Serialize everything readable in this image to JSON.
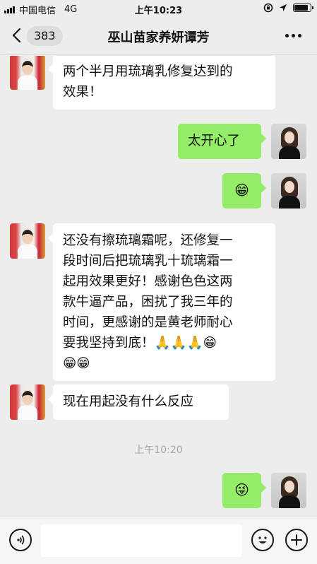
{
  "status_bar": {
    "carrier": "中国电信",
    "network": "4G",
    "time": "上午10:23"
  },
  "nav": {
    "back_count": "383",
    "title": "巫山苗家养妍谭芳"
  },
  "messages": [
    {
      "side": "left",
      "lines": [
        "两个半月用琉璃乳修复达到的",
        "效果！"
      ]
    },
    {
      "side": "right",
      "lines": [
        "太开心了"
      ]
    },
    {
      "side": "right",
      "emoji": "😁"
    },
    {
      "side": "left",
      "lines": [
        "还没有擦琉璃霜呢，还修复一",
        "段时间后把琉璃乳十琉璃霜一",
        "起用效果更好！感谢色色这两",
        "款牛逼产品，困扰了我三年的",
        "时间，更感谢的是黄老师耐心",
        "要我坚持到底！🙏🙏🙏😁",
        "😁😁"
      ]
    },
    {
      "side": "left",
      "lines": [
        "现在用起没有什么反应"
      ]
    },
    {
      "side": "right",
      "emoji": "😜"
    }
  ],
  "timestamp": "上午10:20",
  "input": {
    "placeholder": "",
    "value": ""
  }
}
